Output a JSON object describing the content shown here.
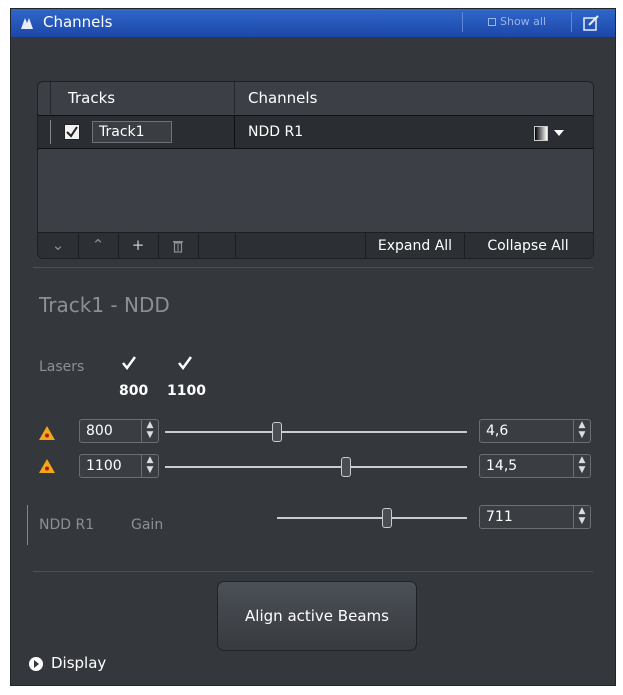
{
  "window": {
    "title": "Channels",
    "show_all": "Show all"
  },
  "tracks_table": {
    "headers": {
      "tracks": "Tracks",
      "channels": "Channels"
    },
    "rows": [
      {
        "track": "Track1",
        "channel": "NDD R1",
        "checked": true
      }
    ],
    "toolbar": {
      "move_down": "⌄",
      "move_up": "⌃",
      "add": "+",
      "delete": "🗑",
      "expand_all": "Expand All",
      "collapse_all": "Collapse All"
    }
  },
  "track_detail": {
    "heading": "Track1 - NDD",
    "lasers_label": "Lasers",
    "lasers": [
      {
        "wavelength": "800",
        "checked": true
      },
      {
        "wavelength": "1100",
        "checked": true
      }
    ],
    "laser_rows": [
      {
        "wavelength": "800",
        "power": "4,6",
        "slider_fraction": 0.37
      },
      {
        "wavelength": "1100",
        "power": "14,5",
        "slider_fraction": 0.6
      }
    ],
    "detector": {
      "name": "NDD R1",
      "gain_label": "Gain",
      "gain_value": "711",
      "slider_fraction": 0.58
    }
  },
  "align_button": "Align active Beams",
  "display_label": "Display",
  "colors": {
    "titlebar": "#1f4fb3",
    "panel": "#34383d",
    "warning": "#f0a81a"
  }
}
